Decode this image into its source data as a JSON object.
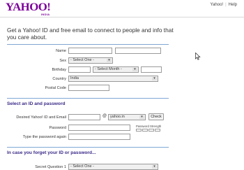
{
  "header": {
    "logo": "YAHOO!",
    "logo_sub": "INDIA",
    "links": [
      "Yahoo!",
      "Help"
    ]
  },
  "intro": "Get a Yahoo! ID and free email to connect to people and info that you care about.",
  "form": {
    "name_label": "Name",
    "sex_label": "Sex",
    "sex_value": "- Select One -",
    "birthday_label": "Birthday",
    "birthday_month": "- Select Month -",
    "country_label": "Country",
    "country_value": "India",
    "postal_label": "Postal Code"
  },
  "section_id": {
    "title": "Select an ID and password",
    "desired_label": "Desired Yahoo! ID and Email",
    "at_symbol": "@",
    "domain_value": "yahoo.in",
    "check_button": "Check",
    "password_label": "Password",
    "strength_label": "Password Strength",
    "retype_label": "Type the password again"
  },
  "section_forgot": {
    "title": "In case you forget your ID or password...",
    "secret_label": "Secret Question 1",
    "secret_value": "- Select One -"
  }
}
